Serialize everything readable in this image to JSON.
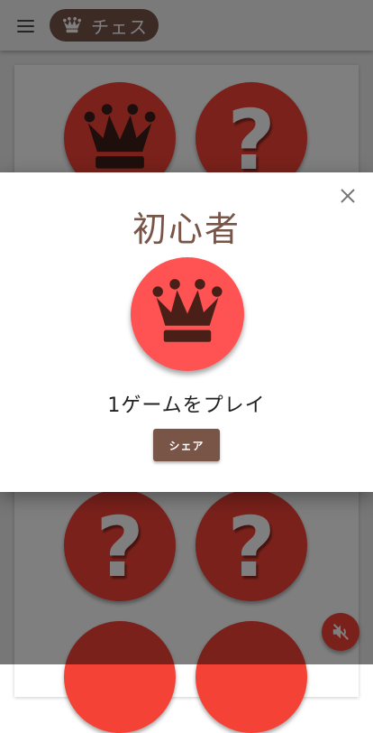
{
  "app_bar": {
    "title": "チェス",
    "menu_icon": "menu-icon",
    "title_icon": "chess-queen-icon"
  },
  "background_grid": {
    "badges": [
      {
        "icon": "chess-queen-icon",
        "locked": false
      },
      {
        "icon": "question-mark-icon",
        "locked": true,
        "glyph": "?"
      },
      {
        "icon": "question-mark-icon",
        "locked": true,
        "glyph": "?"
      },
      {
        "icon": "question-mark-icon",
        "locked": true,
        "glyph": "?"
      },
      {
        "icon": "question-mark-icon",
        "locked": true,
        "glyph": "?"
      },
      {
        "icon": "question-mark-icon",
        "locked": true,
        "glyph": "?"
      }
    ]
  },
  "dialog": {
    "title": "初心者",
    "badge_icon": "chess-queen-icon",
    "description": "1ゲームをプレイ",
    "share_label": "シェア",
    "close_icon": "close-icon"
  },
  "fab": {
    "icon": "volume-off-icon"
  },
  "colors": {
    "primary": "#795548",
    "badge_red": "#f44336",
    "badge_red_light": "#ff5252",
    "queen_dark": "#3e1f18",
    "scrim": "rgba(0,0,0,0.5)"
  }
}
